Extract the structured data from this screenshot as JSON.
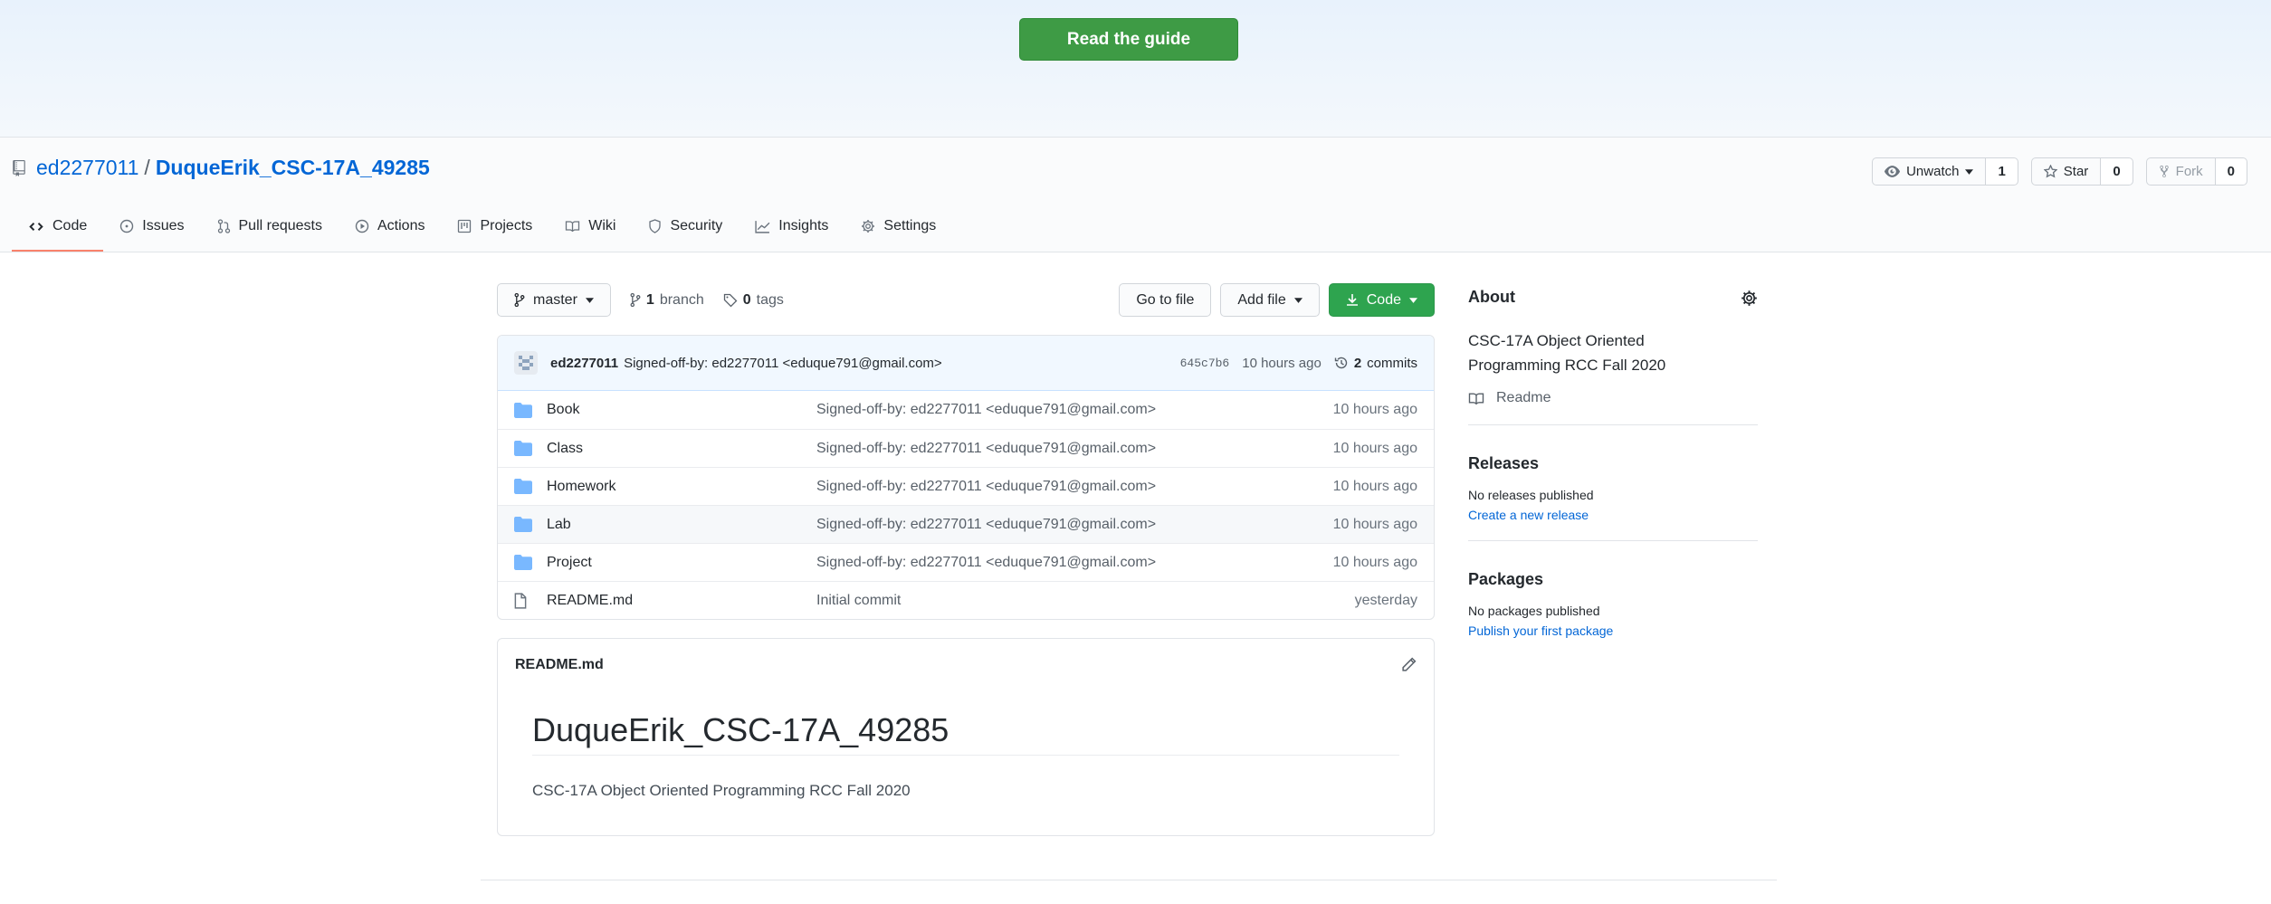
{
  "banner": {
    "guide_button": "Read the guide"
  },
  "repo": {
    "owner": "ed2277011",
    "separator": "/",
    "name": "DuqueErik_CSC-17A_49285"
  },
  "repo_actions": {
    "watch": {
      "label": "Unwatch",
      "count": "1"
    },
    "star": {
      "label": "Star",
      "count": "0"
    },
    "fork": {
      "label": "Fork",
      "count": "0"
    }
  },
  "nav_tabs": [
    {
      "label": "Code",
      "icon": "code-icon"
    },
    {
      "label": "Issues",
      "icon": "issue-icon"
    },
    {
      "label": "Pull requests",
      "icon": "pull-request-icon"
    },
    {
      "label": "Actions",
      "icon": "play-icon"
    },
    {
      "label": "Projects",
      "icon": "project-icon"
    },
    {
      "label": "Wiki",
      "icon": "book-icon"
    },
    {
      "label": "Security",
      "icon": "shield-icon"
    },
    {
      "label": "Insights",
      "icon": "graph-icon"
    },
    {
      "label": "Settings",
      "icon": "gear-icon"
    }
  ],
  "toolbar": {
    "branch": "master",
    "branches_count": "1",
    "branches_label": "branch",
    "tags_count": "0",
    "tags_label": "tags",
    "go_to_file": "Go to file",
    "add_file": "Add file",
    "code": "Code"
  },
  "commit": {
    "author": "ed2277011",
    "message": "Signed-off-by: ed2277011 <eduque791@gmail.com>",
    "sha": "645c7b6",
    "age": "10 hours ago",
    "commits_count": "2",
    "commits_label": "commits"
  },
  "files": [
    {
      "name": "Book",
      "type": "folder",
      "message": "Signed-off-by: ed2277011 <eduque791@gmail.com>",
      "age": "10 hours ago"
    },
    {
      "name": "Class",
      "type": "folder",
      "message": "Signed-off-by: ed2277011 <eduque791@gmail.com>",
      "age": "10 hours ago"
    },
    {
      "name": "Homework",
      "type": "folder",
      "message": "Signed-off-by: ed2277011 <eduque791@gmail.com>",
      "age": "10 hours ago"
    },
    {
      "name": "Lab",
      "type": "folder",
      "message": "Signed-off-by: ed2277011 <eduque791@gmail.com>",
      "age": "10 hours ago"
    },
    {
      "name": "Project",
      "type": "folder",
      "message": "Signed-off-by: ed2277011 <eduque791@gmail.com>",
      "age": "10 hours ago"
    },
    {
      "name": "README.md",
      "type": "file",
      "message": "Initial commit",
      "age": "yesterday"
    }
  ],
  "readme": {
    "filename": "README.md",
    "heading": "DuqueErik_CSC-17A_49285",
    "body": "CSC-17A Object Oriented Programming RCC Fall 2020"
  },
  "sidebar": {
    "about_title": "About",
    "about_desc_line1": "CSC-17A Object Oriented",
    "about_desc_line2": "Programming RCC Fall 2020",
    "readme_link": "Readme",
    "releases_title": "Releases",
    "releases_none": "No releases published",
    "releases_create": "Create a new release",
    "packages_title": "Packages",
    "packages_none": "No packages published",
    "packages_publish": "Publish your first package"
  },
  "colors": {
    "link": "#0366d6",
    "primary_button": "#2ea44f",
    "banner_button": "#3e9b45",
    "active_tab_underline": "#f9826c",
    "folder": "#79b8ff"
  }
}
